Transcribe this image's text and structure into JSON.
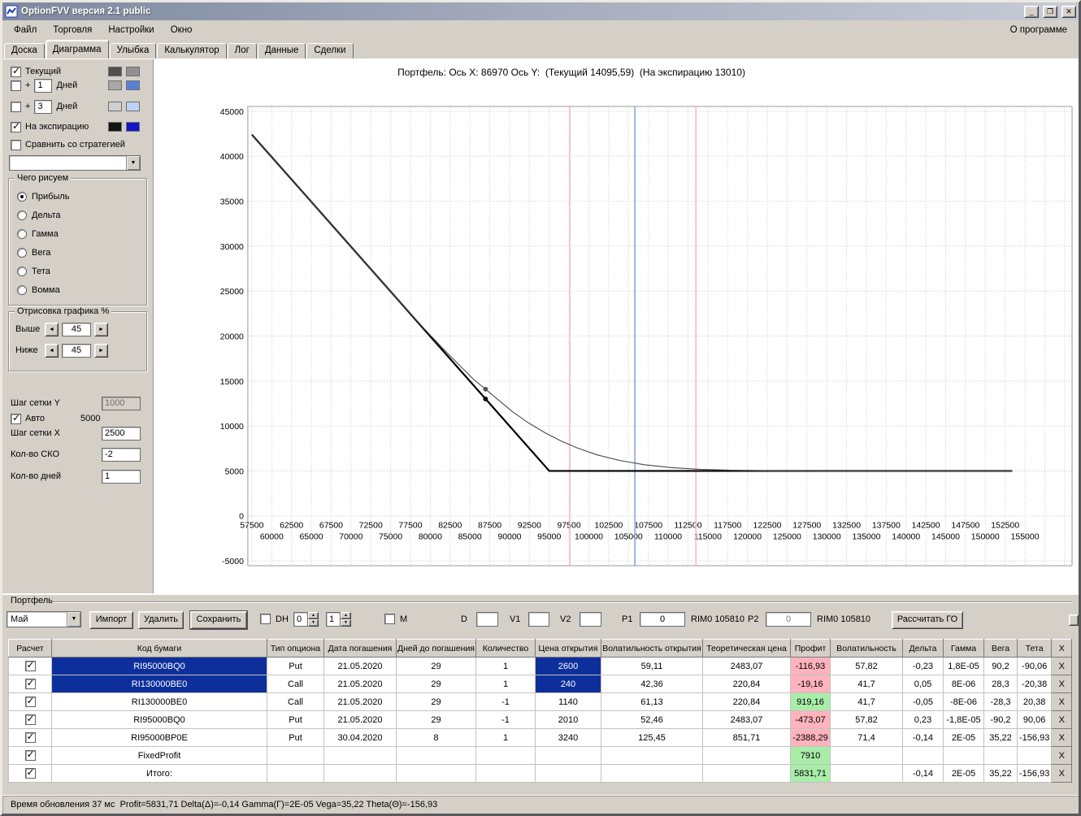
{
  "window": {
    "title": "OptionFVV версия 2.1 public",
    "about_label": "О программе",
    "controls": {
      "minimize": "_",
      "maximize": "❐",
      "close": "✕"
    }
  },
  "menu": {
    "items": [
      {
        "label": "Файл"
      },
      {
        "label": "Торговля"
      },
      {
        "label": "Настройки"
      },
      {
        "label": "Окно"
      }
    ]
  },
  "tabs": {
    "items": [
      {
        "label": "Доска"
      },
      {
        "label": "Диаграмма",
        "active": true
      },
      {
        "label": "Улыбка"
      },
      {
        "label": "Калькулятор"
      },
      {
        "label": "Лог"
      },
      {
        "label": "Данные"
      },
      {
        "label": "Сделки"
      }
    ]
  },
  "left_panel": {
    "current": {
      "label": "Текущий",
      "checked": true,
      "colors": [
        "#4f4f4f",
        "#909090"
      ]
    },
    "plus1": {
      "prefix": "+",
      "value": "1",
      "label": "Дней",
      "checked": false,
      "colors": [
        "#a8a8a8",
        "#5a7fd6"
      ]
    },
    "plus3": {
      "prefix": "+",
      "value": "3",
      "label": "Дней",
      "checked": false,
      "colors": [
        "#cfcfcf",
        "#b9d4f5"
      ]
    },
    "expiry": {
      "label": "На экспирацию",
      "checked": true,
      "colors": [
        "#141414",
        "#1515c8"
      ]
    },
    "compare": {
      "label": "Сравнить со стратегией",
      "checked": false
    },
    "strategy_select": {
      "value": ""
    },
    "draw_group": {
      "title": "Чего рисуем",
      "options": [
        {
          "label": "Прибыль",
          "selected": true
        },
        {
          "label": "Дельта"
        },
        {
          "label": "Гамма"
        },
        {
          "label": "Вега"
        },
        {
          "label": "Тета"
        },
        {
          "label": "Вомма"
        }
      ]
    },
    "render_group": {
      "title": "Отрисовка графика %",
      "rows": [
        {
          "label": "Выше",
          "value": "45"
        },
        {
          "label": "Ниже",
          "value": "45"
        }
      ]
    },
    "grid_y": {
      "label": "Шаг сетки Y",
      "value": "1000"
    },
    "auto": {
      "label": "Авто",
      "checked": true,
      "value": "5000"
    },
    "grid_x": {
      "label": "Шаг сетки X",
      "value": "2500"
    },
    "sko": {
      "label": "Кол-во СКО",
      "value": "-2"
    },
    "days": {
      "label": "Кол-во дней",
      "value": "1"
    }
  },
  "chart_data": {
    "type": "line",
    "title": "Портфель: Ось X: 86970 Ось Y:  (Текущий 14095,59)  (На экспирацию 13010)",
    "x_range": [
      57500,
      155000
    ],
    "y_range": [
      -5000,
      45000
    ],
    "x_tick_step": 2500,
    "y_tick_step": 5000,
    "grid": true,
    "series": [
      {
        "name": "На экспирацию",
        "color": "#000000",
        "width": 2.2,
        "points": [
          [
            57500,
            42407
          ],
          [
            95000,
            5000
          ],
          [
            153400,
            5000
          ]
        ]
      },
      {
        "name": "Текущий",
        "color": "#4a4a4a",
        "width": 1.1,
        "points": [
          [
            57500,
            42407
          ],
          [
            62500,
            37419
          ],
          [
            67500,
            32432
          ],
          [
            72500,
            27444
          ],
          [
            76000,
            23953
          ],
          [
            79000,
            21050
          ],
          [
            81500,
            18700
          ],
          [
            83500,
            16900
          ],
          [
            85500,
            15150
          ],
          [
            86970,
            14096
          ],
          [
            88500,
            12950
          ],
          [
            90500,
            11500
          ],
          [
            92500,
            10280
          ],
          [
            94500,
            9230
          ],
          [
            96500,
            8330
          ],
          [
            98500,
            7570
          ],
          [
            101000,
            6800
          ],
          [
            104000,
            6150
          ],
          [
            107000,
            5690
          ],
          [
            110500,
            5360
          ],
          [
            114000,
            5180
          ],
          [
            118000,
            5080
          ],
          [
            123000,
            5025
          ],
          [
            130000,
            5003
          ],
          [
            153400,
            5000
          ]
        ]
      }
    ],
    "vlines": [
      {
        "x": 97600,
        "color": "#efb3c8",
        "width": 1.4
      },
      {
        "x": 105810,
        "color": "#9fb4d6",
        "width": 2
      },
      {
        "x": 113500,
        "color": "#efb3c8",
        "width": 1.4
      }
    ],
    "markers": [
      {
        "x": 86970,
        "y": 14095.59,
        "color": "#555555"
      },
      {
        "x": 86970,
        "y": 13010,
        "color": "#111111"
      }
    ]
  },
  "portfolio": {
    "group_label": "Портфель",
    "toolbar": {
      "month_value": "Май",
      "import_label": "Импорт",
      "delete_label": "Удалить",
      "save_label": "Сохранить",
      "dh_label": "DH",
      "dh_checked": false,
      "spin1_value": "0",
      "spin2_value": "1",
      "m_label": "M",
      "m_checked": false,
      "d_label": "D",
      "d_value": "",
      "v1_label": "V1",
      "v1_value": "",
      "v2_label": "V2",
      "v2_value": "",
      "p1_label": "P1",
      "p1_value": "0",
      "rim1_label": "RIM0 105810",
      "p2_label": "P2",
      "p2_value": "0",
      "rim2_label": "RIM0 105810",
      "calc_label": "Рассчитать ГО"
    },
    "table": {
      "headers": [
        "Расчет",
        "Код бумаги",
        "Тип опциона",
        "Дата погашения",
        "Дней до погашения",
        "Количество",
        "Цена открытия",
        "Волатильность открытия",
        "Теоретическая цена",
        "Профит",
        "Волатильность",
        "Дельта",
        "Гамма",
        "Вега",
        "Тета",
        "X"
      ],
      "delete_label": "X",
      "rows": [
        {
          "checked": true,
          "selected": true,
          "profit_state": "neg",
          "cells": [
            "RI95000BQ0",
            "Put",
            "21.05.2020",
            "29",
            "1",
            "2600",
            "59,11",
            "2483,07",
            "-116,93",
            "57,82",
            "-0,23",
            "1,8E-05",
            "90,2",
            "-90,06"
          ]
        },
        {
          "checked": true,
          "selected": true,
          "profit_state": "neg",
          "cells": [
            "RI130000BE0",
            "Call",
            "21.05.2020",
            "29",
            "1",
            "240",
            "42,36",
            "220,84",
            "-19,16",
            "41,7",
            "0,05",
            "8E-06",
            "28,3",
            "-20,38"
          ]
        },
        {
          "checked": true,
          "selected": false,
          "profit_state": "pos",
          "cells": [
            "RI130000BE0",
            "Call",
            "21.05.2020",
            "29",
            "-1",
            "1140",
            "61,13",
            "220,84",
            "919,16",
            "41,7",
            "-0,05",
            "-8E-06",
            "-28,3",
            "20,38"
          ]
        },
        {
          "checked": true,
          "selected": false,
          "profit_state": "neg",
          "cells": [
            "RI95000BQ0",
            "Put",
            "21.05.2020",
            "29",
            "-1",
            "2010",
            "52,46",
            "2483,07",
            "-473,07",
            "57,82",
            "0,23",
            "-1,8E-05",
            "-90,2",
            "90,06"
          ]
        },
        {
          "checked": true,
          "selected": false,
          "profit_state": "neg",
          "cells": [
            "RI95000BP0E",
            "Put",
            "30.04.2020",
            "8",
            "1",
            "3240",
            "125,45",
            "851,71",
            "-2388,29",
            "71,4",
            "-0,14",
            "2E-05",
            "35,22",
            "-156,93"
          ]
        },
        {
          "checked": true,
          "selected": false,
          "profit_state": "pos",
          "cells": [
            "FixedProfit",
            "",
            "",
            "",
            "",
            "",
            "",
            "",
            "7910",
            "",
            "",
            "",
            "",
            ""
          ]
        },
        {
          "checked": true,
          "selected": false,
          "profit_state": "pos",
          "cells": [
            "Итого:",
            "",
            "",
            "",
            "",
            "",
            "",
            "",
            "5831,71",
            "",
            "-0,14",
            "2E-05",
            "35,22",
            "-156,93"
          ]
        }
      ]
    }
  },
  "statusbar": {
    "text": "Время обновления 37 мс  Profit=5831,71 Delta(Δ)=-0,14 Gamma(Г)=2E-05 Vega=35,22 Theta(Θ)=-156,93"
  },
  "colors": {
    "selection_bg": "#0d2f9c",
    "profit_neg_bg": "#ffb3bd",
    "profit_pos_bg": "#a9eda9"
  }
}
